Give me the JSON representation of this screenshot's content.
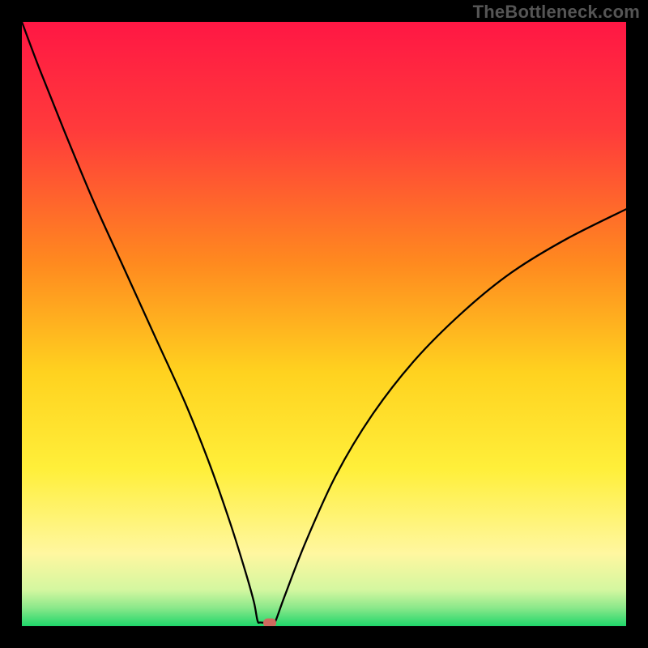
{
  "watermark": "TheBottleneck.com",
  "chart_data": {
    "type": "line",
    "title": "",
    "xlabel": "",
    "ylabel": "",
    "xlim": [
      0,
      100
    ],
    "ylim": [
      0,
      100
    ],
    "gradient_stops": [
      {
        "offset": 0,
        "color": "#ff1744"
      },
      {
        "offset": 18,
        "color": "#ff3b3b"
      },
      {
        "offset": 40,
        "color": "#ff8a1f"
      },
      {
        "offset": 58,
        "color": "#ffd21f"
      },
      {
        "offset": 74,
        "color": "#ffef3a"
      },
      {
        "offset": 88,
        "color": "#fff7a0"
      },
      {
        "offset": 94,
        "color": "#d4f7a0"
      },
      {
        "offset": 97,
        "color": "#8ae88a"
      },
      {
        "offset": 100,
        "color": "#1fd66a"
      }
    ],
    "curve_points": [
      {
        "x": 0.0,
        "y": 100.0
      },
      {
        "x": 3.0,
        "y": 92.0
      },
      {
        "x": 7.0,
        "y": 82.0
      },
      {
        "x": 12.0,
        "y": 70.0
      },
      {
        "x": 17.0,
        "y": 59.0
      },
      {
        "x": 22.0,
        "y": 48.0
      },
      {
        "x": 27.0,
        "y": 37.0
      },
      {
        "x": 31.0,
        "y": 27.0
      },
      {
        "x": 34.5,
        "y": 17.0
      },
      {
        "x": 37.0,
        "y": 9.0
      },
      {
        "x": 38.4,
        "y": 4.0
      },
      {
        "x": 39.0,
        "y": 0.9
      },
      {
        "x": 39.5,
        "y": 0.6
      },
      {
        "x": 41.5,
        "y": 0.6
      },
      {
        "x": 42.0,
        "y": 0.9
      },
      {
        "x": 43.5,
        "y": 5.0
      },
      {
        "x": 47.0,
        "y": 14.0
      },
      {
        "x": 52.0,
        "y": 25.0
      },
      {
        "x": 58.0,
        "y": 35.0
      },
      {
        "x": 65.0,
        "y": 44.0
      },
      {
        "x": 73.0,
        "y": 52.0
      },
      {
        "x": 81.0,
        "y": 58.5
      },
      {
        "x": 90.0,
        "y": 64.0
      },
      {
        "x": 100.0,
        "y": 69.0
      }
    ],
    "marker": {
      "x": 41.0,
      "y": 0.6
    }
  }
}
